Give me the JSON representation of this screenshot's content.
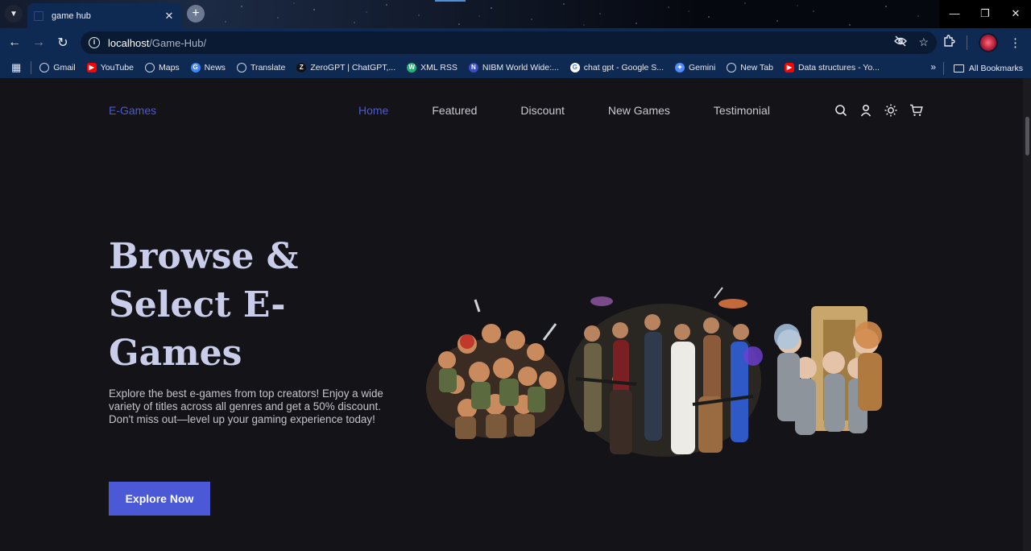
{
  "browser": {
    "tab": {
      "title": "game hub"
    },
    "url": {
      "host": "localhost",
      "path": "/Game-Hub/"
    },
    "bookmarks": [
      {
        "label": "Gmail",
        "icon": "globe-icon",
        "color": "#8ab4f8"
      },
      {
        "label": "YouTube",
        "icon": "youtube-icon",
        "color": "#ff0000"
      },
      {
        "label": "Maps",
        "icon": "globe-icon",
        "color": "#8ab4f8"
      },
      {
        "label": "News",
        "icon": "news-icon",
        "color": "#4285f4"
      },
      {
        "label": "Translate",
        "icon": "globe-icon",
        "color": "#8ab4f8"
      },
      {
        "label": "ZeroGPT | ChatGPT,...",
        "icon": "zerogpt-icon",
        "color": "#111111"
      },
      {
        "label": "XML RSS",
        "icon": "w-icon",
        "color": "#21b573"
      },
      {
        "label": "NIBM World Wide:...",
        "icon": "nibm-icon",
        "color": "#3b4cc0"
      },
      {
        "label": "chat gpt - Google S...",
        "icon": "google-icon",
        "color": "#ffffff"
      },
      {
        "label": "Gemini",
        "icon": "gemini-icon",
        "color": "#4e8cff"
      },
      {
        "label": "New Tab",
        "icon": "globe-icon",
        "color": "#8ab4f8"
      },
      {
        "label": "Data structures - Yo...",
        "icon": "youtube-icon",
        "color": "#ff0000"
      }
    ],
    "all_bookmarks": "All Bookmarks"
  },
  "site": {
    "logo": "E-Games",
    "nav": [
      "Home",
      "Featured",
      "Discount",
      "New Games",
      "Testimonial"
    ],
    "active_nav": "Home",
    "accent": "#4b59d6",
    "hero": {
      "title": "Browse & Select E-Games",
      "description": "Explore the best e-games from top creators! Enjoy a wide variety of titles across all genres and get a 50% discount. Don't miss out—level up your gaming experience today!",
      "cta": "Explore Now"
    }
  }
}
